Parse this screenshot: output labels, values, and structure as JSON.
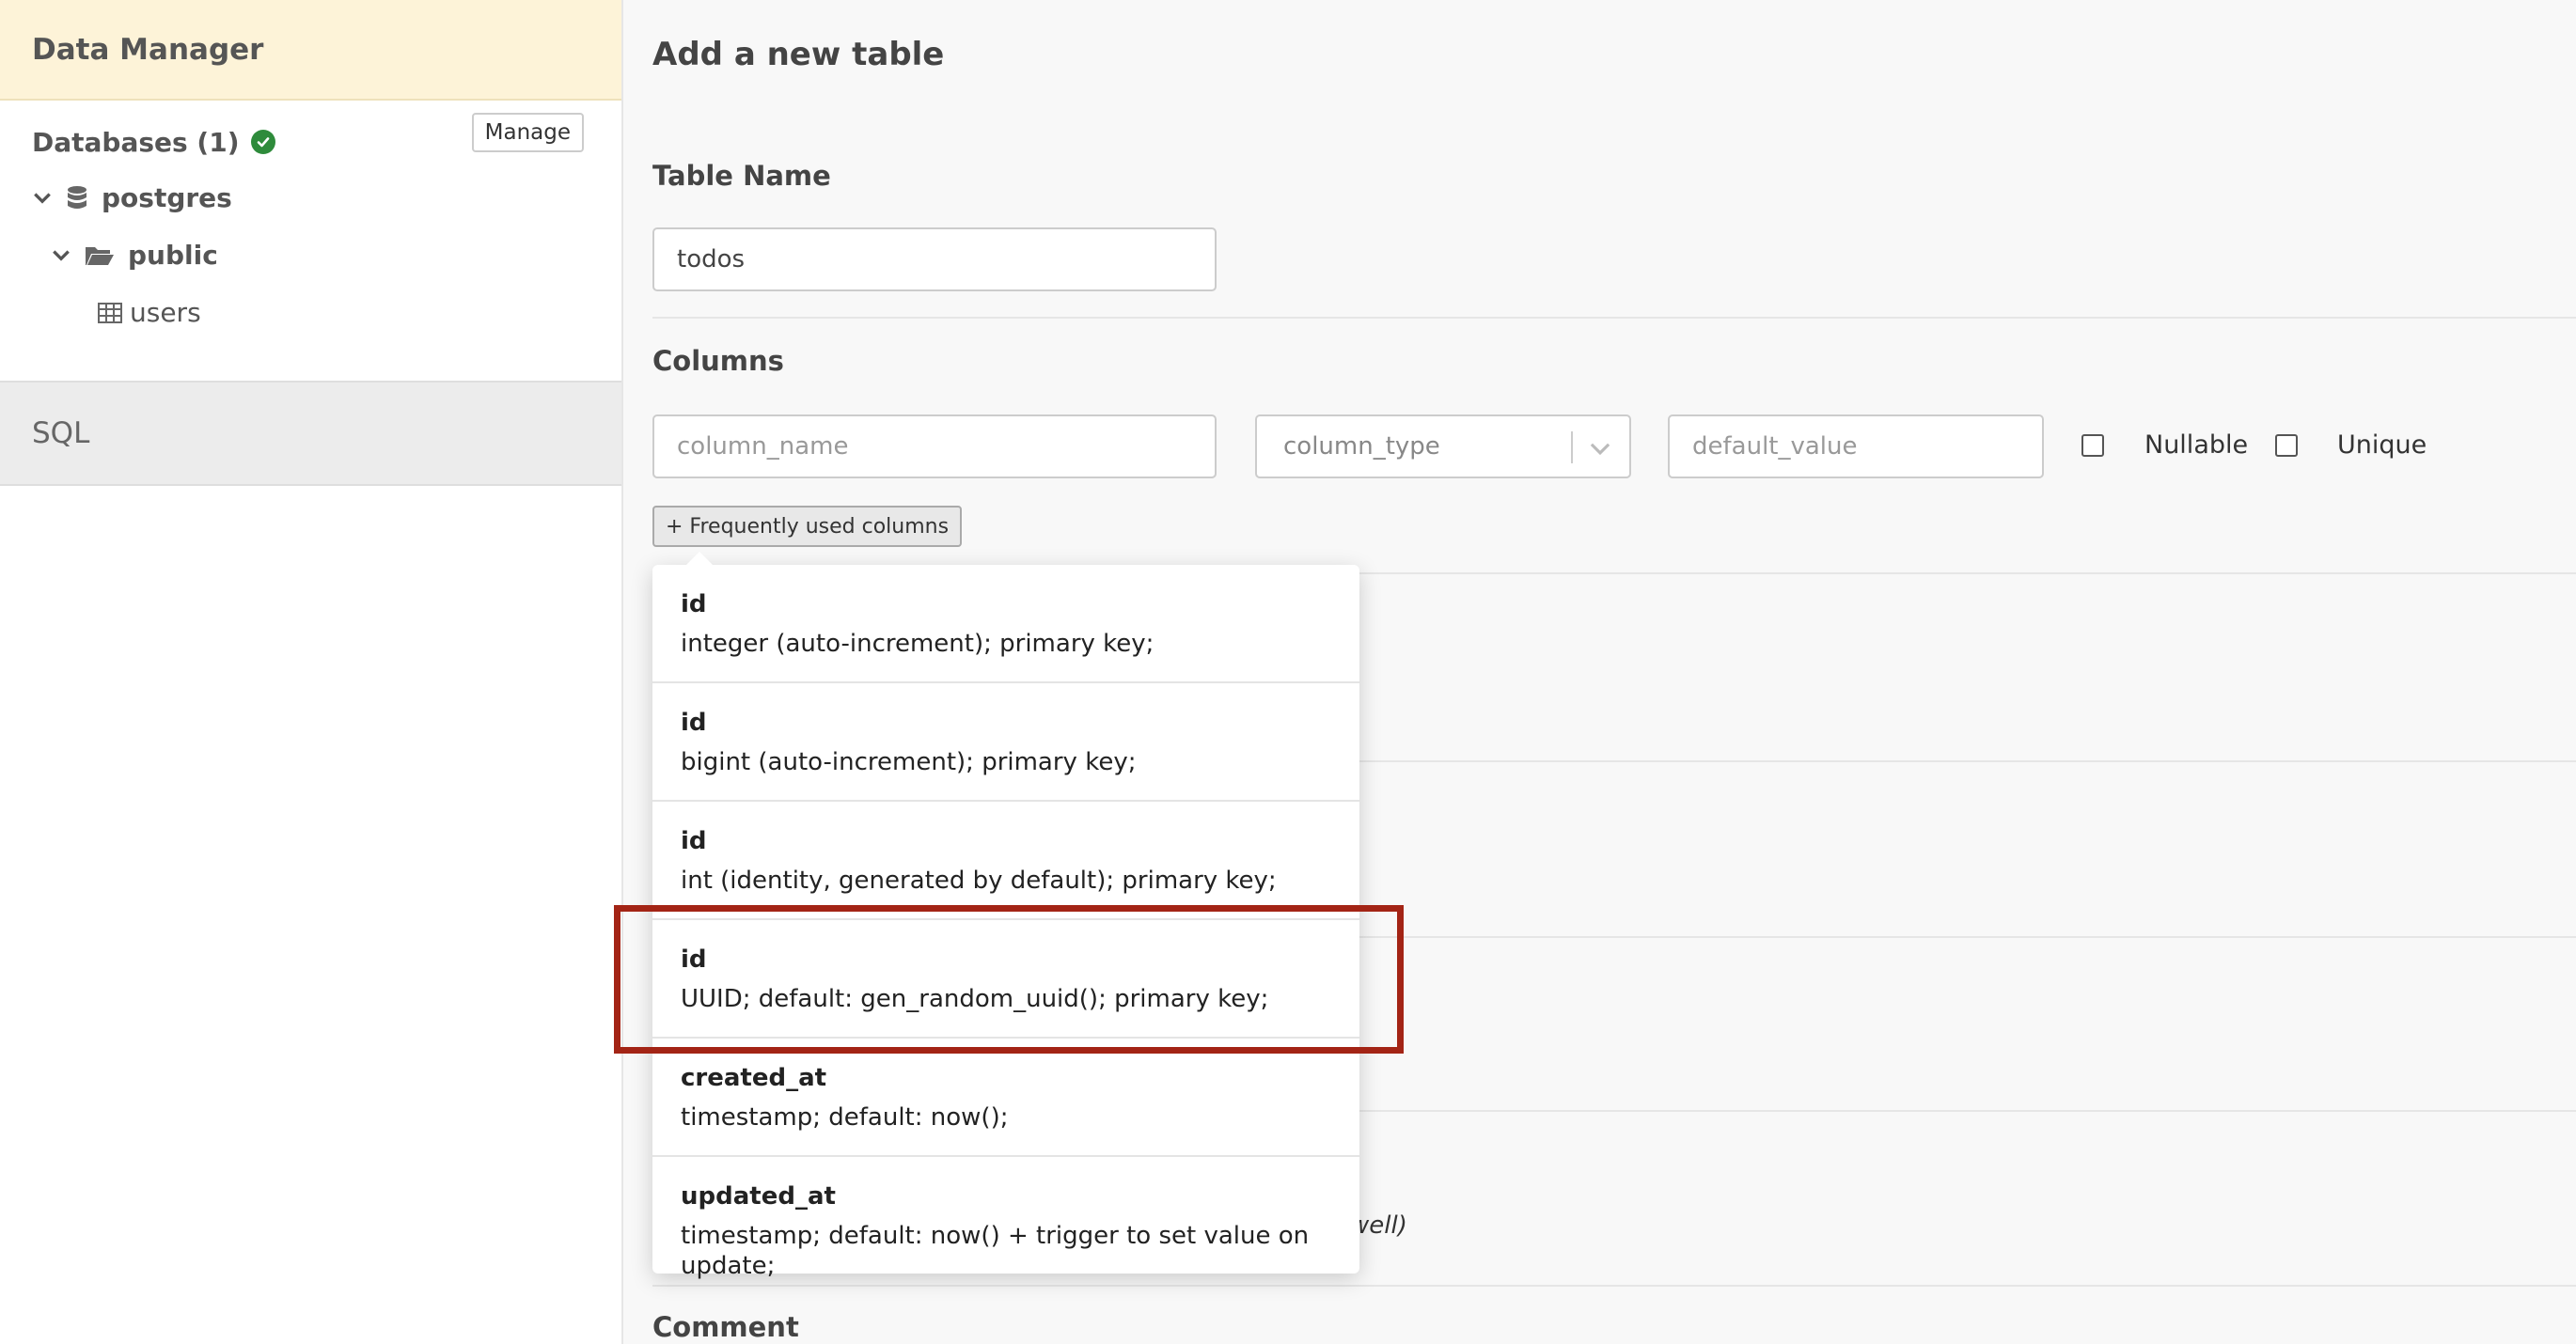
{
  "sidebar": {
    "title": "Data Manager",
    "databases_label": "Databases (1)",
    "manage_label": "Manage",
    "tree": {
      "database": "postgres",
      "schema": "public",
      "table": "users"
    },
    "sql_tab": "SQL"
  },
  "main": {
    "title": "Add a new table",
    "table_name_label": "Table Name",
    "table_name_value": "todos",
    "columns_label": "Columns",
    "column_name_placeholder": "column_name",
    "column_type_placeholder": "column_type",
    "default_value_placeholder": "default_value",
    "nullable_label": "Nullable",
    "unique_label": "Unique",
    "frequent_button": "+ Frequently used columns",
    "partial_text": "well)",
    "comment_label": "Comment"
  },
  "frequent_columns": [
    {
      "name": "id",
      "desc": "integer (auto-increment); primary key;"
    },
    {
      "name": "id",
      "desc": "bigint (auto-increment); primary key;"
    },
    {
      "name": "id",
      "desc": "int (identity, generated by default); primary key;"
    },
    {
      "name": "id",
      "desc": "UUID; default: gen_random_uuid(); primary key;"
    },
    {
      "name": "created_at",
      "desc": "timestamp; default: now();"
    },
    {
      "name": "updated_at",
      "desc": "timestamp; default: now() + trigger to set value on update;"
    }
  ],
  "colors": {
    "header_bg": "#fdf3d8",
    "success": "#2e8b3b",
    "highlight_border": "#a32415"
  }
}
